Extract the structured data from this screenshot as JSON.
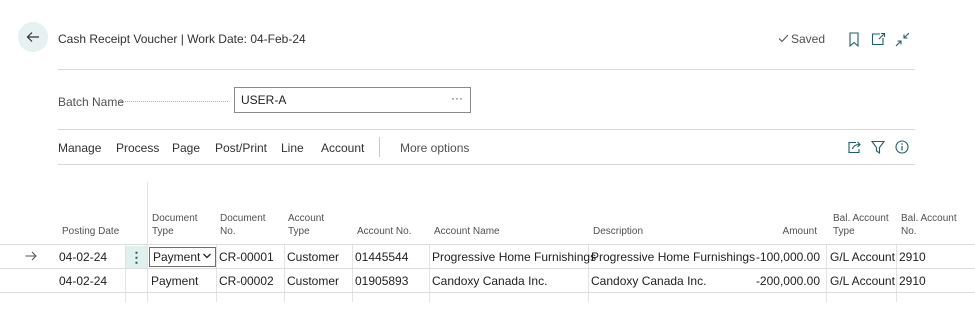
{
  "header": {
    "title": "Cash Receipt Voucher | Work Date: 04-Feb-24",
    "saved_label": "Saved"
  },
  "batch": {
    "label": "Batch Name",
    "value": "USER-A",
    "more": "···"
  },
  "actions": {
    "items": [
      "Manage",
      "Process",
      "Page",
      "Post/Print",
      "Line",
      "Account"
    ],
    "more_options": "More options"
  },
  "table": {
    "headers": {
      "posting_date": "Posting Date",
      "document_type_1": "Document",
      "document_type_2": "Type",
      "document_no_1": "Document",
      "document_no_2": "No.",
      "account_type_1": "Account",
      "account_type_2": "Type",
      "account_no": "Account No.",
      "account_name": "Account Name",
      "description": "Description",
      "amount": "Amount",
      "bal_account_type_1": "Bal. Account",
      "bal_account_type_2": "Type",
      "bal_account_no_1": "Bal. Account",
      "bal_account_no_2": "No."
    },
    "rows": [
      {
        "posting_date": "04-02-24",
        "document_type": "Payment",
        "document_no": "CR-00001",
        "account_type": "Customer",
        "account_no": "01445544",
        "account_name": "Progressive Home Furnishings",
        "description": "Progressive Home Furnishings",
        "amount": "-100,000.00",
        "bal_account_type": "G/L Account",
        "bal_account_no": "2910"
      },
      {
        "posting_date": "04-02-24",
        "document_type": "Payment",
        "document_no": "CR-00002",
        "account_type": "Customer",
        "account_no": "01905893",
        "account_name": "Candoxy Canada Inc.",
        "description": "Candoxy Canada Inc.",
        "amount": "-200,000.00",
        "bal_account_type": "G/L Account",
        "bal_account_no": "2910"
      }
    ]
  },
  "icons": {
    "back": "arrow-left-icon",
    "saved_check": "checkmark-icon",
    "bookmark": "bookmark-icon",
    "open_new": "open-in-new-window-icon",
    "collapse": "collapse-icon",
    "share": "share-icon",
    "filter": "filter-icon",
    "info": "info-icon",
    "row_pointer": "row-arrow-icon",
    "row_menu": "vertical-ellipsis-icon",
    "dropdown": "chevron-down-icon"
  },
  "colors": {
    "accent": "#1c5f6e",
    "selected_cell": "#dff0ef",
    "back_button_bg": "#e6f1f2"
  }
}
